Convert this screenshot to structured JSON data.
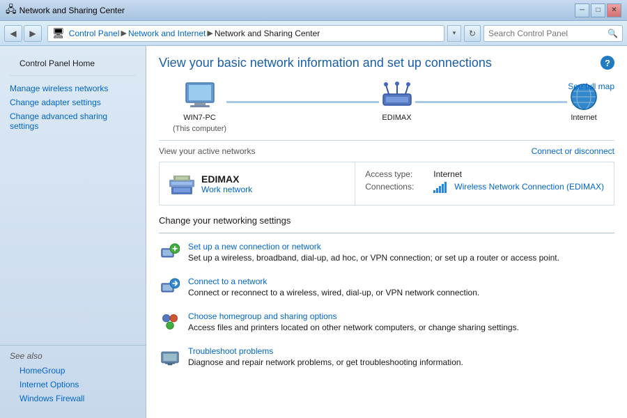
{
  "window": {
    "title": "Network and Sharing Center",
    "controls": {
      "minimize": "─",
      "maximize": "□",
      "close": "✕"
    }
  },
  "addressbar": {
    "back": "◀",
    "forward": "▶",
    "breadcrumbs": [
      {
        "label": "Control Panel",
        "sep": "▶"
      },
      {
        "label": "Network and Internet",
        "sep": "▶"
      },
      {
        "label": "Network and Sharing Center"
      }
    ],
    "dropdown": "▾",
    "refresh": "↻",
    "search_placeholder": "Search Control Panel"
  },
  "sidebar": {
    "home_label": "Control Panel Home",
    "links": [
      {
        "label": "Manage wireless networks"
      },
      {
        "label": "Change adapter settings"
      },
      {
        "label": "Change advanced sharing settings"
      }
    ],
    "see_also": {
      "title": "See also",
      "items": [
        {
          "label": "HomeGroup"
        },
        {
          "label": "Internet Options"
        },
        {
          "label": "Windows Firewall"
        }
      ]
    }
  },
  "content": {
    "help_icon": "?",
    "title": "View your basic network information and set up connections",
    "see_full_map": "See full map",
    "diagram": {
      "nodes": [
        {
          "label": "WIN7-PC",
          "sublabel": "(This computer)"
        },
        {
          "label": "EDIMAX",
          "sublabel": ""
        },
        {
          "label": "Internet",
          "sublabel": ""
        }
      ]
    },
    "active_networks_label": "View your active networks",
    "connect_disconnect": "Connect or disconnect",
    "active_network": {
      "name": "EDIMAX",
      "type": "Work network",
      "access_type_label": "Access type:",
      "access_type_value": "Internet",
      "connections_label": "Connections:",
      "connections_link": "Wireless Network Connection (EDIMAX)"
    },
    "settings_section": {
      "title": "Change your networking settings",
      "items": [
        {
          "link": "Set up a new connection or network",
          "desc": "Set up a wireless, broadband, dial-up, ad hoc, or VPN connection; or set up a router or access point."
        },
        {
          "link": "Connect to a network",
          "desc": "Connect or reconnect to a wireless, wired, dial-up, or VPN network connection."
        },
        {
          "link": "Choose homegroup and sharing options",
          "desc": "Access files and printers located on other network computers, or change sharing settings."
        },
        {
          "link": "Troubleshoot problems",
          "desc": "Diagnose and repair network problems, or get troubleshooting information."
        }
      ]
    }
  }
}
